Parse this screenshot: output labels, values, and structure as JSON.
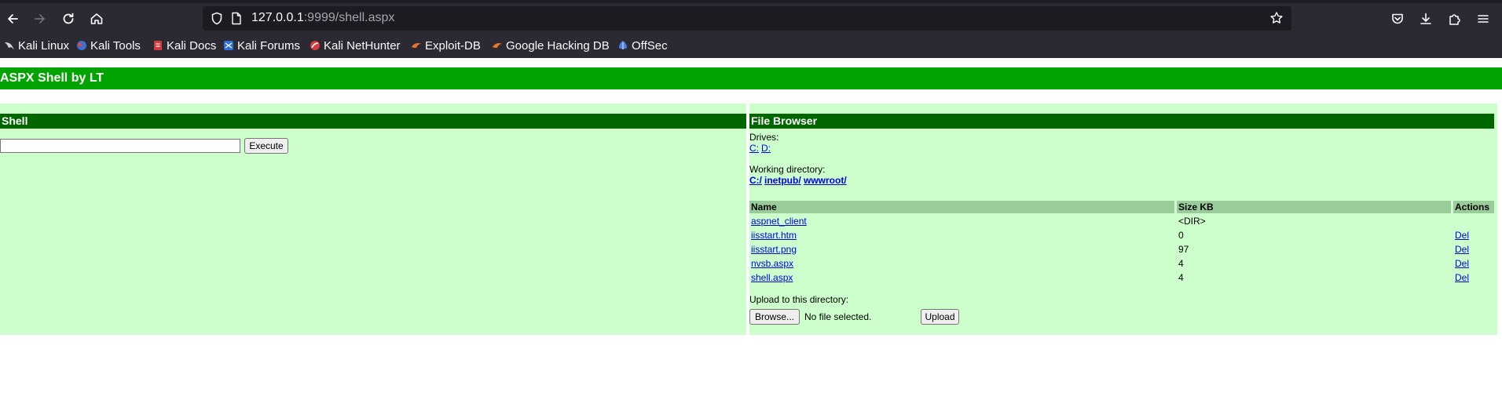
{
  "browser": {
    "url_host": "127.0.0.1",
    "url_rest": ":9999/shell.aspx",
    "bookmarks": [
      {
        "label": "Kali Linux",
        "icon": "kali-dragon-icon"
      },
      {
        "label": "Kali Tools",
        "icon": "kali-tools-icon"
      },
      {
        "label": "Kali Docs",
        "icon": "kali-docs-icon"
      },
      {
        "label": "Kali Forums",
        "icon": "kali-forums-icon"
      },
      {
        "label": "Kali NetHunter",
        "icon": "kali-nethunter-icon"
      },
      {
        "label": "Exploit-DB",
        "icon": "exploit-db-icon"
      },
      {
        "label": "Google Hacking DB",
        "icon": "ghdb-icon"
      },
      {
        "label": "OffSec",
        "icon": "offsec-icon"
      }
    ]
  },
  "page": {
    "title": "ASPX Shell by LT",
    "shell": {
      "header": "Shell",
      "input_value": "",
      "execute_label": "Execute"
    },
    "file_browser": {
      "header": "File Browser",
      "drives_label": "Drives:",
      "drives": [
        "C:",
        "D:"
      ],
      "working_dir_label": "Working directory:",
      "working_dir_parts": [
        "C:/",
        "inetpub/",
        "wwwroot/"
      ],
      "columns": [
        "Name",
        "Size KB",
        "Actions"
      ],
      "rows": [
        {
          "name": "aspnet_client",
          "size": "<DIR>",
          "action": ""
        },
        {
          "name": "iisstart.htm",
          "size": "0",
          "action": "Del"
        },
        {
          "name": "iisstart.png",
          "size": "97",
          "action": "Del"
        },
        {
          "name": "nvsb.aspx",
          "size": "4",
          "action": "Del"
        },
        {
          "name": "shell.aspx",
          "size": "4",
          "action": "Del"
        }
      ],
      "upload_label": "Upload to this directory:",
      "browse_label": "Browse...",
      "no_file_text": "No file selected.",
      "upload_button": "Upload"
    }
  }
}
